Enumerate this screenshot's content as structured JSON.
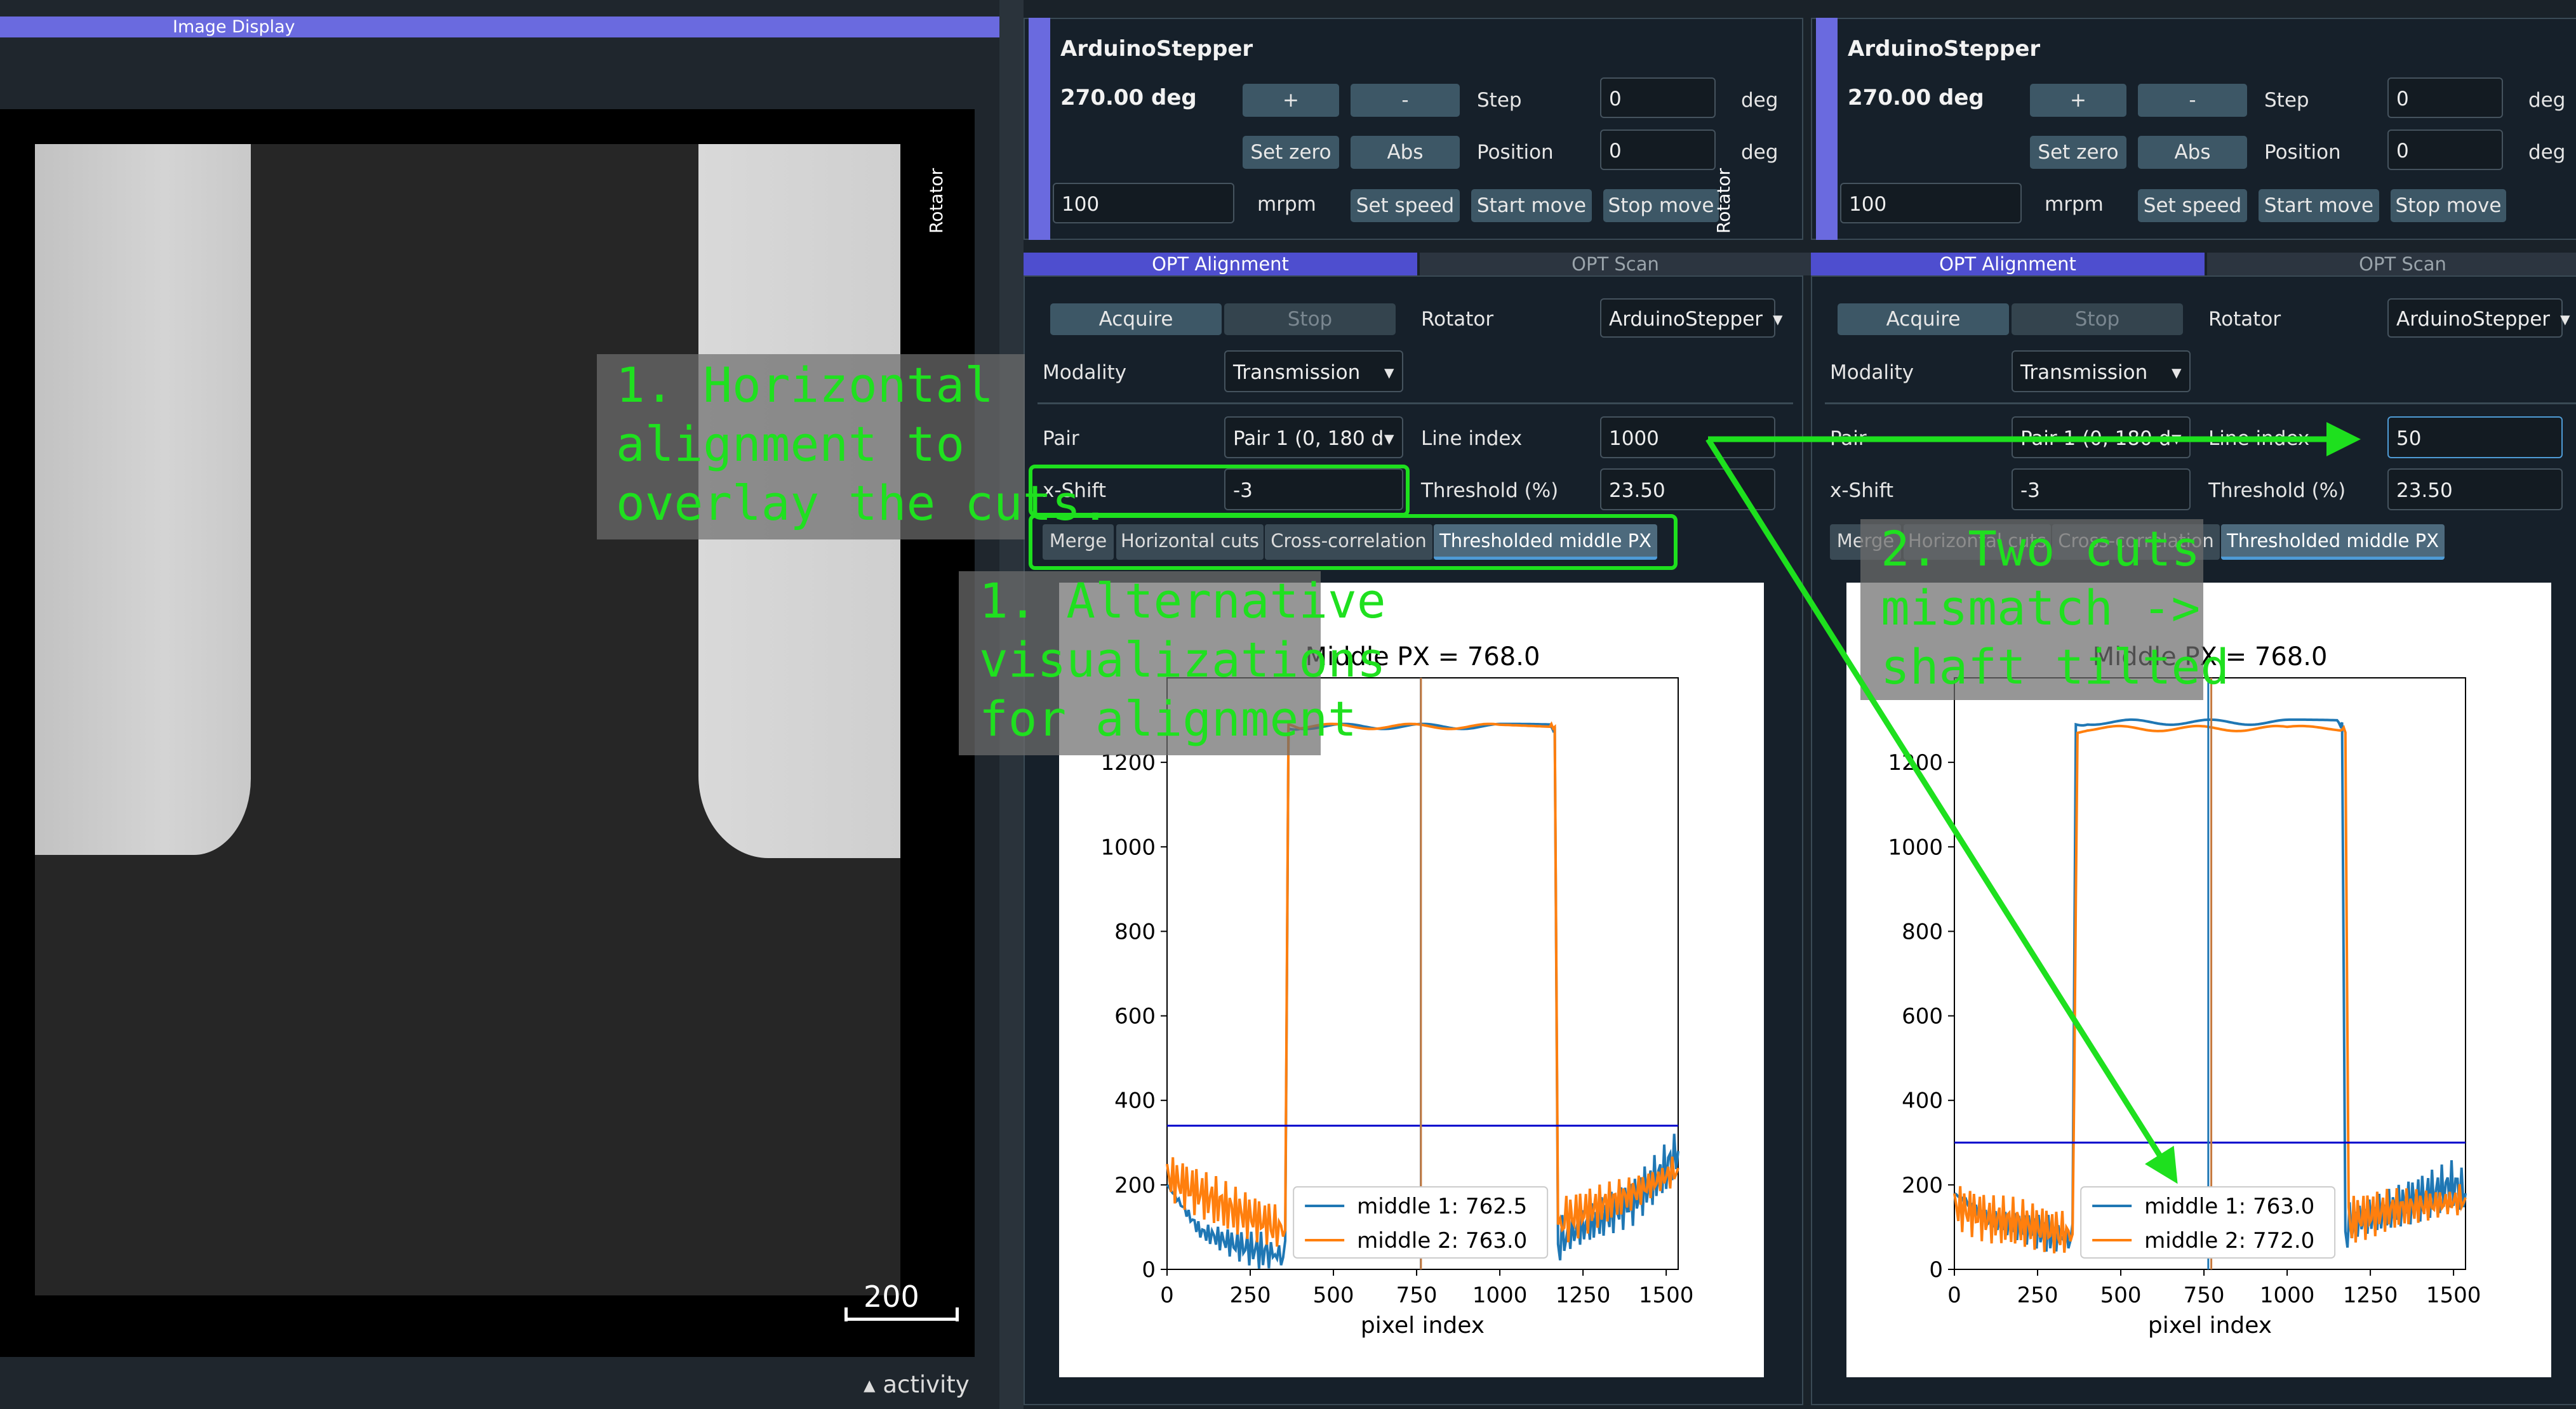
{
  "image_display": {
    "title": "Image Display",
    "scalebar": "200",
    "activity": "activity"
  },
  "panels": [
    {
      "rotator_label": "Rotator",
      "device": "ArduinoStepper",
      "angle": "270.00 deg",
      "plus": "+",
      "minus": "-",
      "step_label": "Step",
      "step_value": "0",
      "step_unit": "deg",
      "set_zero": "Set zero",
      "abs": "Abs",
      "position_label": "Position",
      "position_value": "0",
      "position_unit": "deg",
      "speed_value": "100",
      "speed_unit": "mrpm",
      "set_speed": "Set speed",
      "start_move": "Start move",
      "stop_move": "Stop move",
      "tab1": "OPT Alignment",
      "tab2": "OPT Scan",
      "acquire": "Acquire",
      "stop": "Stop",
      "rotator_select_label": "Rotator",
      "rotator_select": "ArduinoStepper",
      "modality_label": "Modality",
      "modality": "Transmission",
      "pair_label": "Pair",
      "pair": "Pair 1 (0, 180 d",
      "line_index_label": "Line index",
      "line_index": "1000",
      "xshift_label": "x-Shift",
      "xshift": "-3",
      "threshold_label": "Threshold (%)",
      "threshold": "23.50",
      "subtabs": [
        "Merge",
        "Horizontal cuts",
        "Cross-correlation",
        "Thresholded middle PX"
      ],
      "plot": {
        "title": "Middle PX = 768.0",
        "legend1": "middle 1: 762.5",
        "legend2": "middle 2: 763.0",
        "xlabel": "pixel index"
      }
    },
    {
      "rotator_label": "Rotator",
      "device": "ArduinoStepper",
      "angle": "270.00 deg",
      "plus": "+",
      "minus": "-",
      "step_label": "Step",
      "step_value": "0",
      "step_unit": "deg",
      "set_zero": "Set zero",
      "abs": "Abs",
      "position_label": "Position",
      "position_value": "0",
      "position_unit": "deg",
      "speed_value": "100",
      "speed_unit": "mrpm",
      "set_speed": "Set speed",
      "start_move": "Start move",
      "stop_move": "Stop move",
      "tab1": "OPT Alignment",
      "tab2": "OPT Scan",
      "acquire": "Acquire",
      "stop": "Stop",
      "rotator_select_label": "Rotator",
      "rotator_select": "ArduinoStepper",
      "modality_label": "Modality",
      "modality": "Transmission",
      "pair_label": "Pair",
      "pair": "Pair 1 (0, 180 d",
      "line_index_label": "Line index",
      "line_index": "50",
      "xshift_label": "x-Shift",
      "xshift": "-3",
      "threshold_label": "Threshold (%)",
      "threshold": "23.50",
      "subtabs": [
        "Merge",
        "Horizontal cuts",
        "Cross-correlation",
        "Thresholded middle PX"
      ],
      "plot": {
        "title": "Middle PX = 768.0",
        "legend1": "middle 1: 763.0",
        "legend2": "middle 2: 772.0",
        "xlabel": "pixel index"
      }
    }
  ],
  "annotations": {
    "a1_line1": "1. Horizontal",
    "a1_line2": "alignment to",
    "a1_line3": "overlay the cuts.",
    "a2_line1": "1. Alternative",
    "a2_line2": "visualizations",
    "a2_line3": "for alignment",
    "a3_line1": "2. Two cuts",
    "a3_line2": "mismatch ->",
    "a3_line3": "shaft tilted"
  },
  "chart_data": [
    {
      "type": "line",
      "title": "Middle PX = 768.0",
      "xlabel": "pixel index",
      "xlim": [
        0,
        1536
      ],
      "ylim": [
        0,
        1400
      ],
      "xticks": [
        0,
        250,
        500,
        750,
        1000,
        1250,
        1500
      ],
      "yticks": [
        0,
        200,
        400,
        600,
        800,
        1000,
        1200
      ],
      "threshold": 340,
      "middle_lines": [
        762.5,
        763.0
      ],
      "series": [
        {
          "name": "middle 1: 762.5",
          "color": "#1f77b4",
          "x": [
            0,
            100,
            200,
            300,
            355,
            365,
            400,
            600,
            800,
            1000,
            1150,
            1165,
            1175,
            1200,
            1300,
            1400,
            1500,
            1536
          ],
          "y": [
            200,
            90,
            60,
            40,
            30,
            1280,
            1285,
            1285,
            1285,
            1285,
            1285,
            1280,
            60,
            80,
            120,
            160,
            240,
            280
          ]
        },
        {
          "name": "middle 2: 763.0",
          "color": "#ff7f0e",
          "x": [
            0,
            100,
            200,
            300,
            355,
            365,
            400,
            600,
            800,
            1000,
            1150,
            1165,
            1175,
            1200,
            1300,
            1400,
            1500,
            1536
          ],
          "y": [
            220,
            180,
            140,
            110,
            90,
            1285,
            1285,
            1285,
            1285,
            1285,
            1285,
            1285,
            100,
            120,
            150,
            180,
            220,
            240
          ]
        }
      ]
    },
    {
      "type": "line",
      "title": "Middle PX = 768.0",
      "xlabel": "pixel index",
      "xlim": [
        0,
        1536
      ],
      "ylim": [
        0,
        1400
      ],
      "xticks": [
        0,
        250,
        500,
        750,
        1000,
        1250,
        1500
      ],
      "yticks": [
        0,
        200,
        400,
        600,
        800,
        1000,
        1200
      ],
      "threshold": 300,
      "middle_lines": [
        763.0,
        772.0
      ],
      "series": [
        {
          "name": "middle 1: 763.0",
          "color": "#1f77b4",
          "x": [
            0,
            100,
            200,
            300,
            355,
            365,
            400,
            600,
            800,
            1000,
            1150,
            1165,
            1175,
            1200,
            1300,
            1400,
            1500,
            1536
          ],
          "y": [
            180,
            120,
            100,
            80,
            70,
            1290,
            1295,
            1295,
            1295,
            1295,
            1295,
            1290,
            90,
            110,
            140,
            170,
            200,
            180
          ]
        },
        {
          "name": "middle 2: 772.0",
          "color": "#ff7f0e",
          "x": [
            0,
            100,
            200,
            300,
            355,
            370,
            400,
            600,
            800,
            1000,
            1160,
            1175,
            1185,
            1200,
            1300,
            1400,
            1500,
            1536
          ],
          "y": [
            150,
            120,
            110,
            90,
            80,
            1275,
            1280,
            1280,
            1280,
            1280,
            1280,
            1275,
            100,
            120,
            140,
            150,
            160,
            170
          ]
        }
      ]
    }
  ]
}
